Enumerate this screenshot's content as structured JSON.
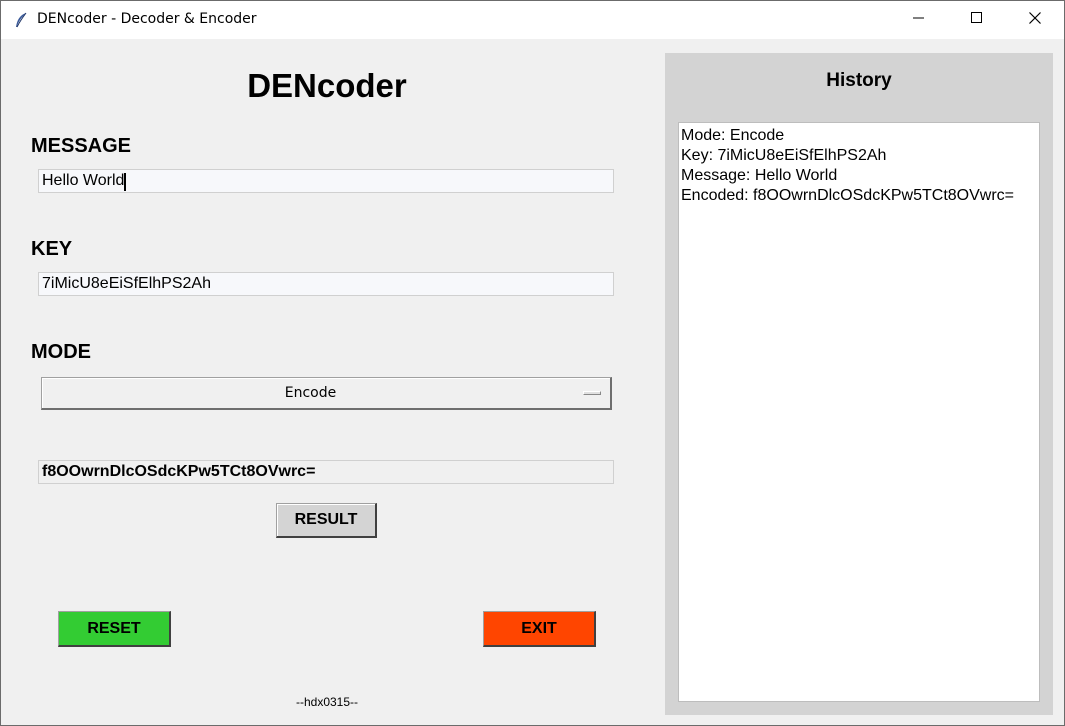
{
  "window": {
    "title": "DENcoder - Decoder & Encoder"
  },
  "app": {
    "title": "DENcoder",
    "credit": "--hdx0315--"
  },
  "message": {
    "label": "MESSAGE",
    "value": "Hello World"
  },
  "key": {
    "label": "KEY",
    "value": "7iMicU8eEiSfElhPS2Ah"
  },
  "mode": {
    "label": "MODE",
    "selected": "Encode"
  },
  "result": {
    "value": "f8OOwrnDlcOSdcKPw5TCt8OVwrc=",
    "button_label": "RESULT"
  },
  "buttons": {
    "reset_label": "RESET",
    "exit_label": "EXIT",
    "reset_color": "#33cc33",
    "exit_color": "#ff4500"
  },
  "history": {
    "title": "History",
    "lines": [
      "Mode: Encode",
      "Key: 7iMicU8eEiSfElhPS2Ah",
      "Message: Hello World",
      "Encoded: f8OOwrnDlcOSdcKPw5TCt8OVwrc="
    ]
  },
  "icons": {
    "app": "feather-icon",
    "minimize": "minimize-icon",
    "maximize": "maximize-icon",
    "close": "close-icon"
  }
}
